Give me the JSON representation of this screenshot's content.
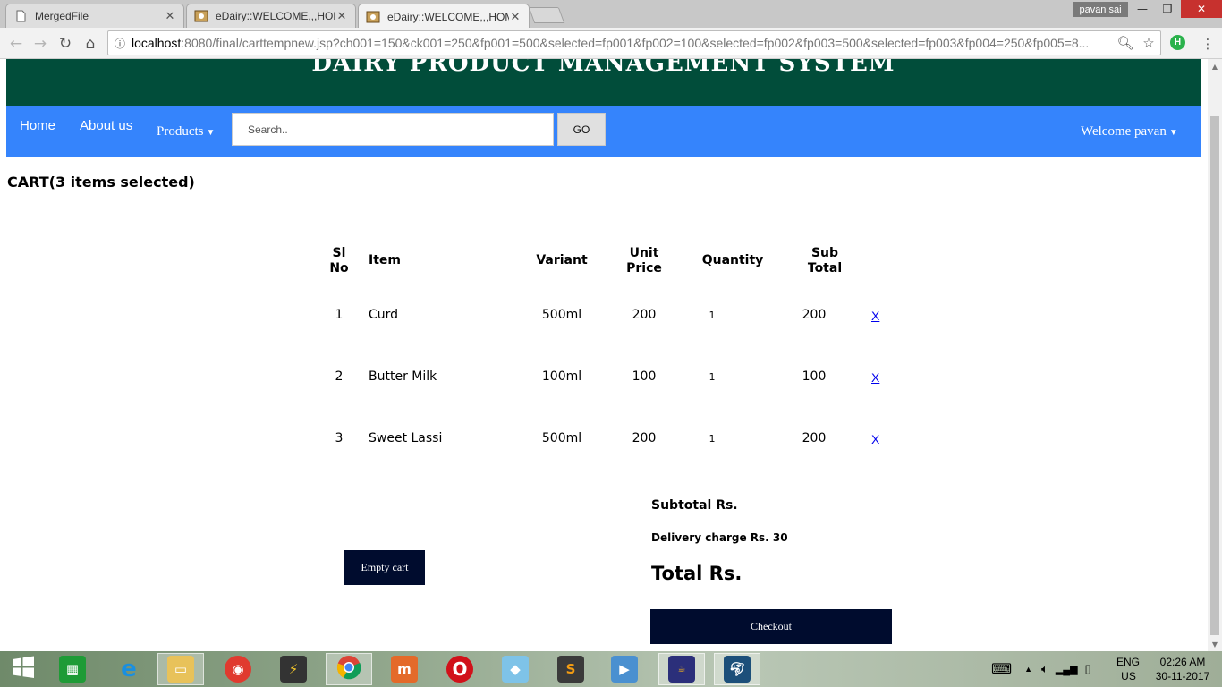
{
  "browser": {
    "tabs": [
      {
        "title": "MergedFile",
        "active": false
      },
      {
        "title": "eDairy::WELCOME,,,HOME",
        "active": false
      },
      {
        "title": "eDairy::WELCOME,,,HOME",
        "active": true
      }
    ],
    "user_name": "pavan sai",
    "url_host": "localhost",
    "url_rest": ":8080/final/carttempnew.jsp?ch001=150&ck001=250&fp001=500&selected=fp001&fp002=100&selected=fp002&fp003=500&selected=fp003&fp004=250&fp005=8...",
    "extension_letter": "H"
  },
  "site": {
    "title": "DAIRY PRODUCT MANAGEMENT SYSTEM",
    "nav": {
      "home": "Home",
      "about": "About us",
      "products": "Products",
      "search_placeholder": "Search..",
      "go": "GO",
      "welcome": "Welcome pavan"
    }
  },
  "cart": {
    "heading": "CART(3 items selected)",
    "columns": {
      "sl_1": "Sl",
      "sl_2": "No",
      "item": "Item",
      "variant": "Variant",
      "unit_1": "Unit",
      "unit_2": "Price",
      "quantity": "Quantity",
      "sub_1": "Sub",
      "sub_2": "Total"
    },
    "rows": [
      {
        "sl": "1",
        "item": "Curd",
        "variant": "500ml",
        "price": "200",
        "qty": "1",
        "subtotal": "200",
        "remove": "X"
      },
      {
        "sl": "2",
        "item": "Butter Milk",
        "variant": "100ml",
        "price": "100",
        "qty": "1",
        "subtotal": "100",
        "remove": "X"
      },
      {
        "sl": "3",
        "item": "Sweet Lassi",
        "variant": "500ml",
        "price": "200",
        "qty": "1",
        "subtotal": "200",
        "remove": "X"
      }
    ],
    "subtotal_label": "Subtotal Rs.",
    "delivery_label": "Delivery charge Rs. 30",
    "total_label": "Total Rs.",
    "empty_cart": "Empty cart",
    "checkout": "Checkout"
  },
  "taskbar": {
    "apps": [
      {
        "icon": "windows-start-icon"
      },
      {
        "icon": "store-icon"
      },
      {
        "icon": "internet-explorer-icon"
      },
      {
        "icon": "file-explorer-icon"
      },
      {
        "icon": "app-icon"
      },
      {
        "icon": "winamp-icon"
      },
      {
        "icon": "chrome-icon"
      },
      {
        "icon": "micromax-icon"
      },
      {
        "icon": "opera-icon"
      },
      {
        "icon": "photos-icon"
      },
      {
        "icon": "sublime-text-icon"
      },
      {
        "icon": "media-player-icon"
      },
      {
        "icon": "java-ee-ide-icon"
      },
      {
        "icon": "mysql-icon"
      }
    ],
    "lang_1": "ENG",
    "lang_2": "US",
    "time": "02:26 AM",
    "date": "30-11-2017"
  }
}
